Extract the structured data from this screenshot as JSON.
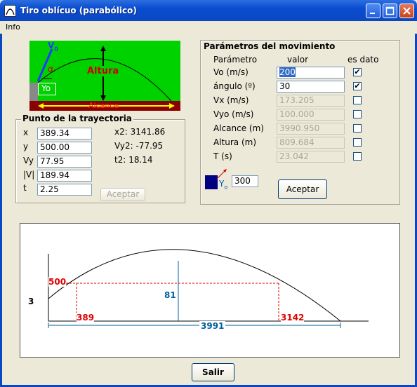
{
  "window": {
    "title": "Tiro oblícuo (parabólico)"
  },
  "menu": {
    "info": "Info"
  },
  "diagram": {
    "v0": "V",
    "v0_sub": "0",
    "alpha": "α",
    "yo": "Yo",
    "altura": "Altura",
    "alcance": "Alcance"
  },
  "punto": {
    "title": "Punto de la trayectoria",
    "x_label": "x",
    "x_value": "389.34",
    "y_label": "y",
    "y_value": "500.00",
    "vy_label": "Vy",
    "vy_value": "77.95",
    "v_label": "|V|",
    "v_value": "189.94",
    "t_label": "t",
    "t_value": "2.25",
    "x2": "x2: 3141.86",
    "vy2": "Vy2: -77.95",
    "t2": "t2:  18.14",
    "accept_label": "Aceptar"
  },
  "params": {
    "title": "Parámetros del movimiento",
    "col_param": "Parámetro",
    "col_valor": "valor",
    "col_dato": "es dato",
    "rows": [
      {
        "label": "Vo (m/s)",
        "value": "200",
        "checked": "✔",
        "enabled": true
      },
      {
        "label": "ángulo (º)",
        "value": "30",
        "checked": "✔",
        "enabled": true
      },
      {
        "label": "Vx (m/s)",
        "value": "173.205",
        "checked": "",
        "enabled": false
      },
      {
        "label": "Vyo (m/s)",
        "value": "100.000",
        "checked": "",
        "enabled": false
      },
      {
        "label": "Alcance (m)",
        "value": "3990.950",
        "checked": "",
        "enabled": false
      },
      {
        "label": "Altura (m)",
        "value": "809.684",
        "checked": "",
        "enabled": false
      },
      {
        "label": "T (s)",
        "value": "23.042",
        "checked": "",
        "enabled": false
      }
    ],
    "yo_label": "Y",
    "yo_sub": "o",
    "yo_value": "300",
    "accept_label": "Aceptar"
  },
  "plot": {
    "left_label": "3",
    "y_label": "500",
    "height_label": "81",
    "x1_label": "389",
    "x2_label": "3142",
    "range_label": "3991"
  },
  "footer": {
    "exit_label": "Salir"
  },
  "colors": {
    "green": "#00d200",
    "darkred": "#8b0000",
    "red": "#e00000",
    "blue": "#0060a0",
    "navy": "#000080"
  }
}
